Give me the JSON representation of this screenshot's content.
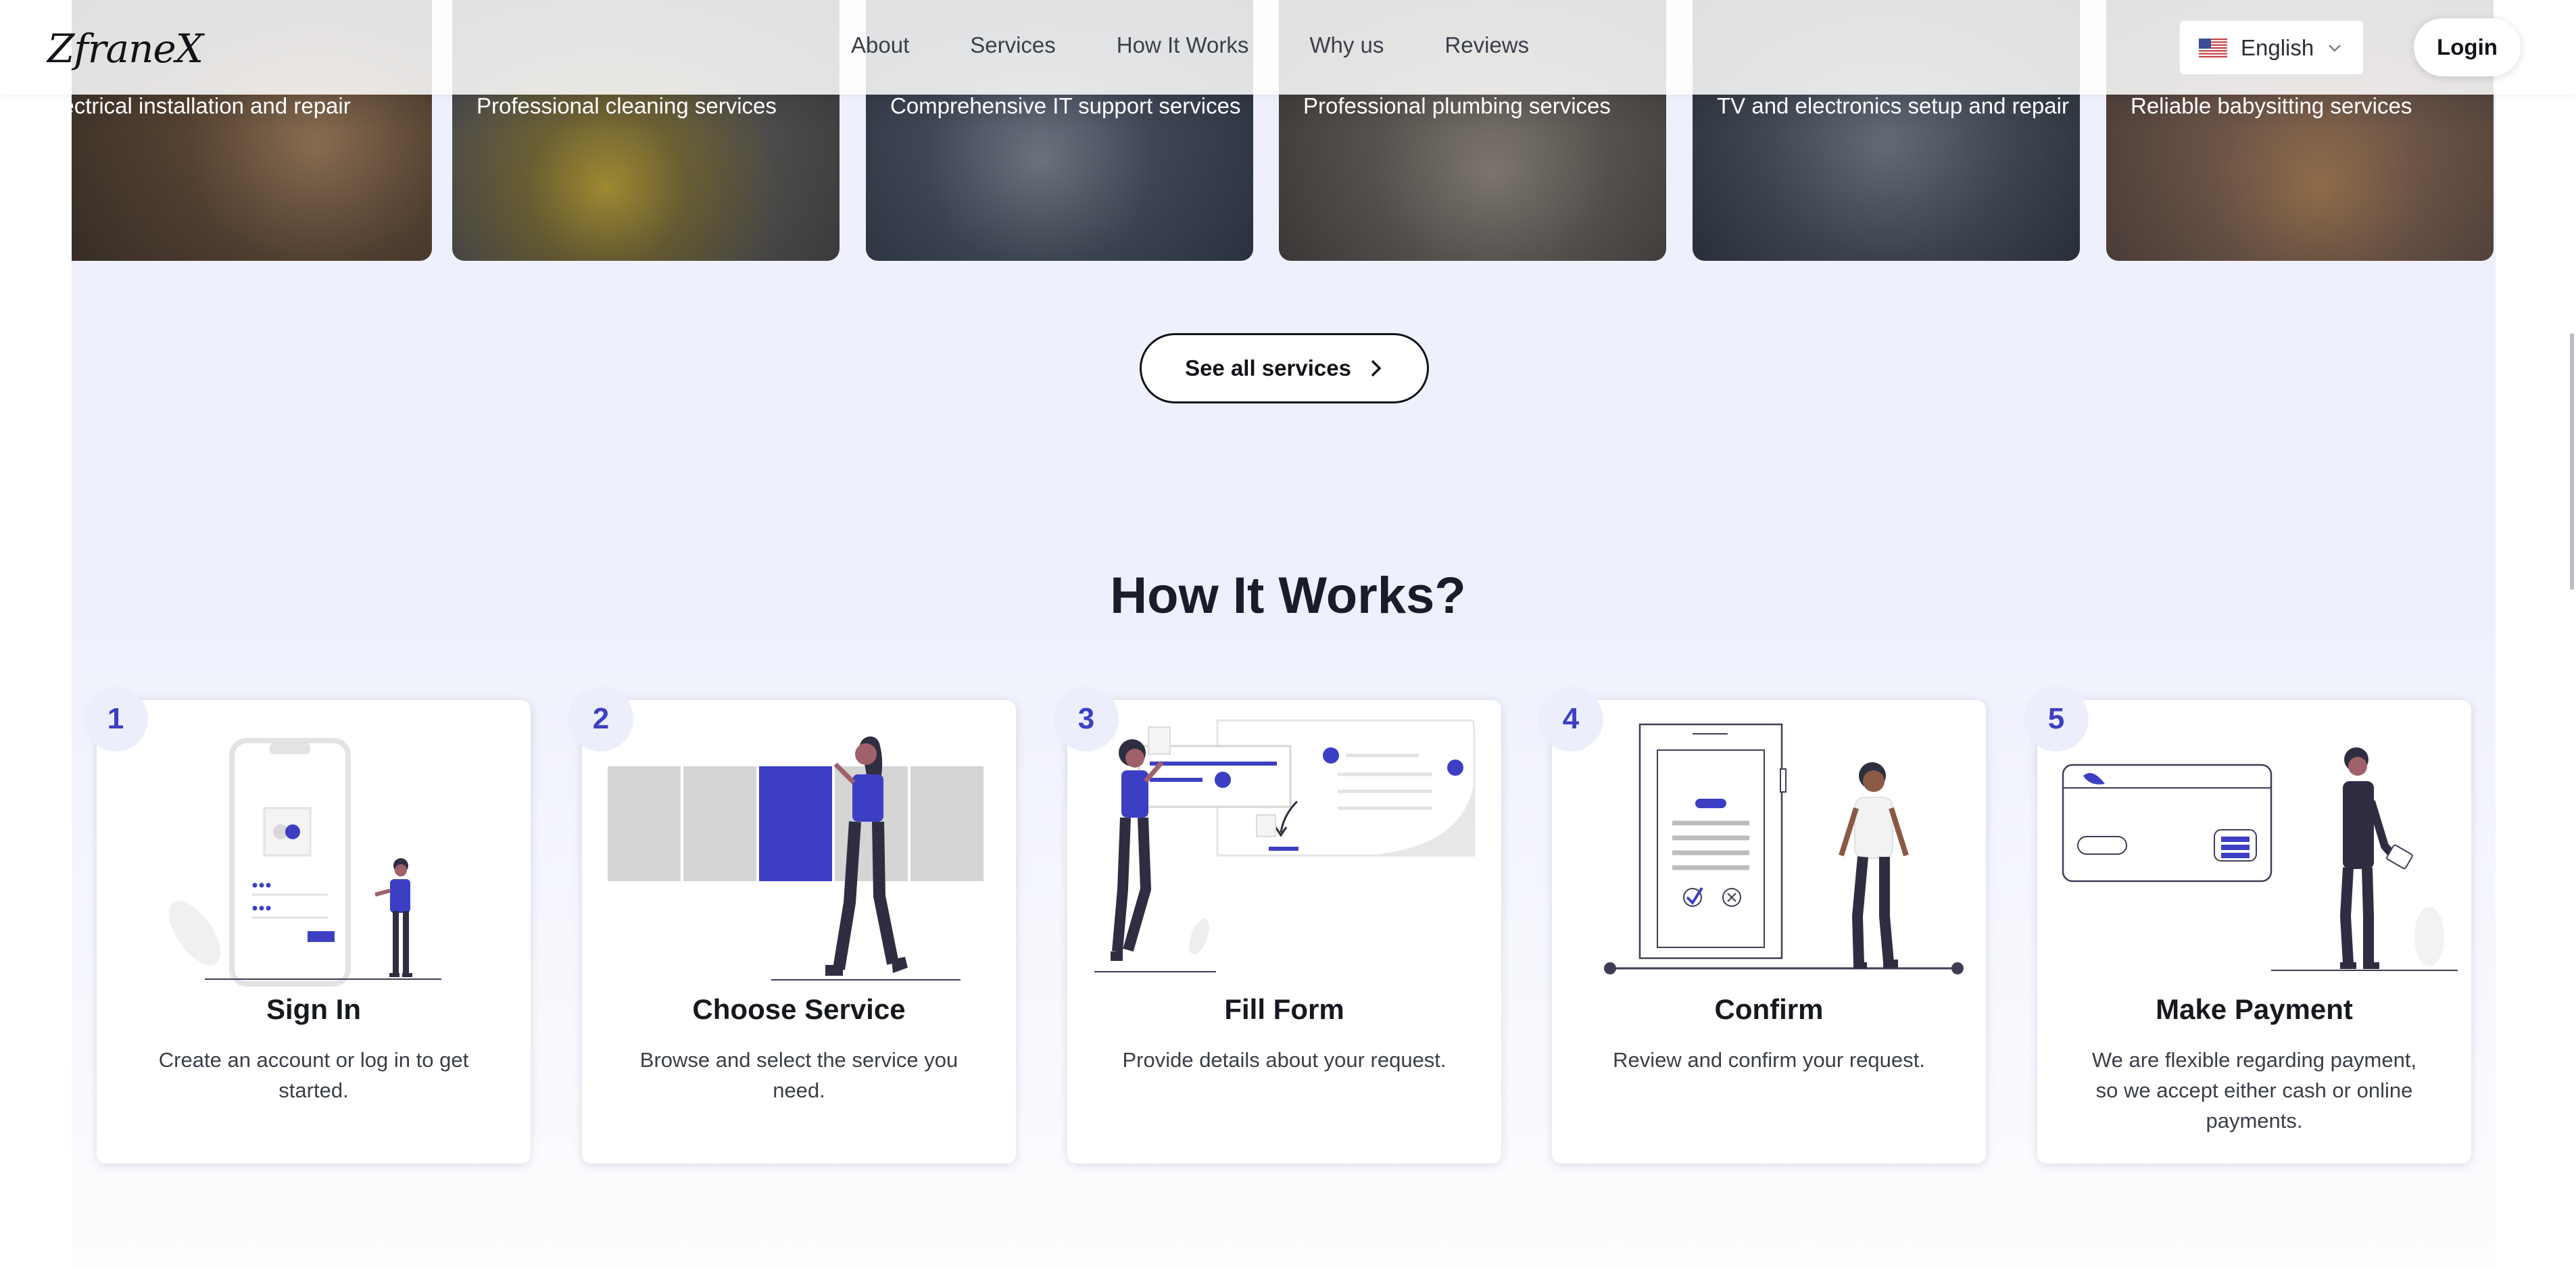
{
  "nav": {
    "logo": "ZfraneX",
    "links": [
      "About",
      "Services",
      "How It Works",
      "Why us",
      "Reviews"
    ],
    "language": "English",
    "login": "Login"
  },
  "services": [
    {
      "caption": "Electrical installation and repair"
    },
    {
      "caption": "Professional cleaning services"
    },
    {
      "caption": "Comprehensive IT support services"
    },
    {
      "caption": "Professional plumbing services"
    },
    {
      "caption": "TV and electronics setup and repair"
    },
    {
      "caption": "Reliable babysitting services"
    }
  ],
  "see_all": "See all services",
  "how": {
    "title": "How It Works?",
    "steps": [
      {
        "num": "1",
        "title": "Sign In",
        "desc": "Create an account or log in to get started."
      },
      {
        "num": "2",
        "title": "Choose Service",
        "desc": "Browse and select the service you need."
      },
      {
        "num": "3",
        "title": "Fill Form",
        "desc": "Provide details about your request."
      },
      {
        "num": "4",
        "title": "Confirm",
        "desc": "Review and confirm your request."
      },
      {
        "num": "5",
        "title": "Make Payment",
        "desc": "We are flexible regarding payment, so we accept either cash or online payments."
      }
    ]
  },
  "colors": {
    "accent": "#3c3fc4",
    "band": "#eef0fc",
    "text": "#16181f"
  }
}
